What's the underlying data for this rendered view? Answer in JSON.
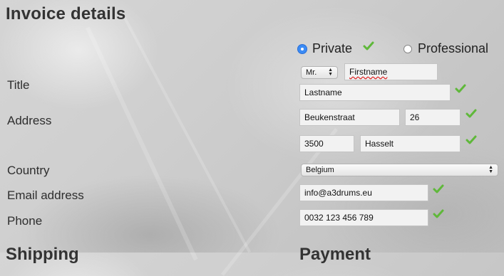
{
  "page": {
    "title": "Invoice details"
  },
  "customer_type": {
    "private_label": "Private",
    "professional_label": "Professional",
    "selected": "Private"
  },
  "labels": {
    "title": "Title",
    "address": "Address",
    "country": "Country",
    "email": "Email address",
    "phone": "Phone"
  },
  "fields": {
    "salutation": "Mr.",
    "firstname": "Firstname",
    "lastname": "Lastname",
    "street": "Beukenstraat",
    "number": "26",
    "postal_code": "3500",
    "city": "Hasselt",
    "country": "Belgium",
    "email": "info@a3drums.eu",
    "phone": "0032 123 456 789"
  },
  "footer": {
    "left_heading": "Shipping",
    "right_heading": "Payment"
  },
  "colors": {
    "check": "#5fb83a",
    "radio_accent": "#3b8bf5"
  },
  "icons": {
    "valid": "checkmark-icon",
    "select_arrows": "select-arrows-icon"
  }
}
